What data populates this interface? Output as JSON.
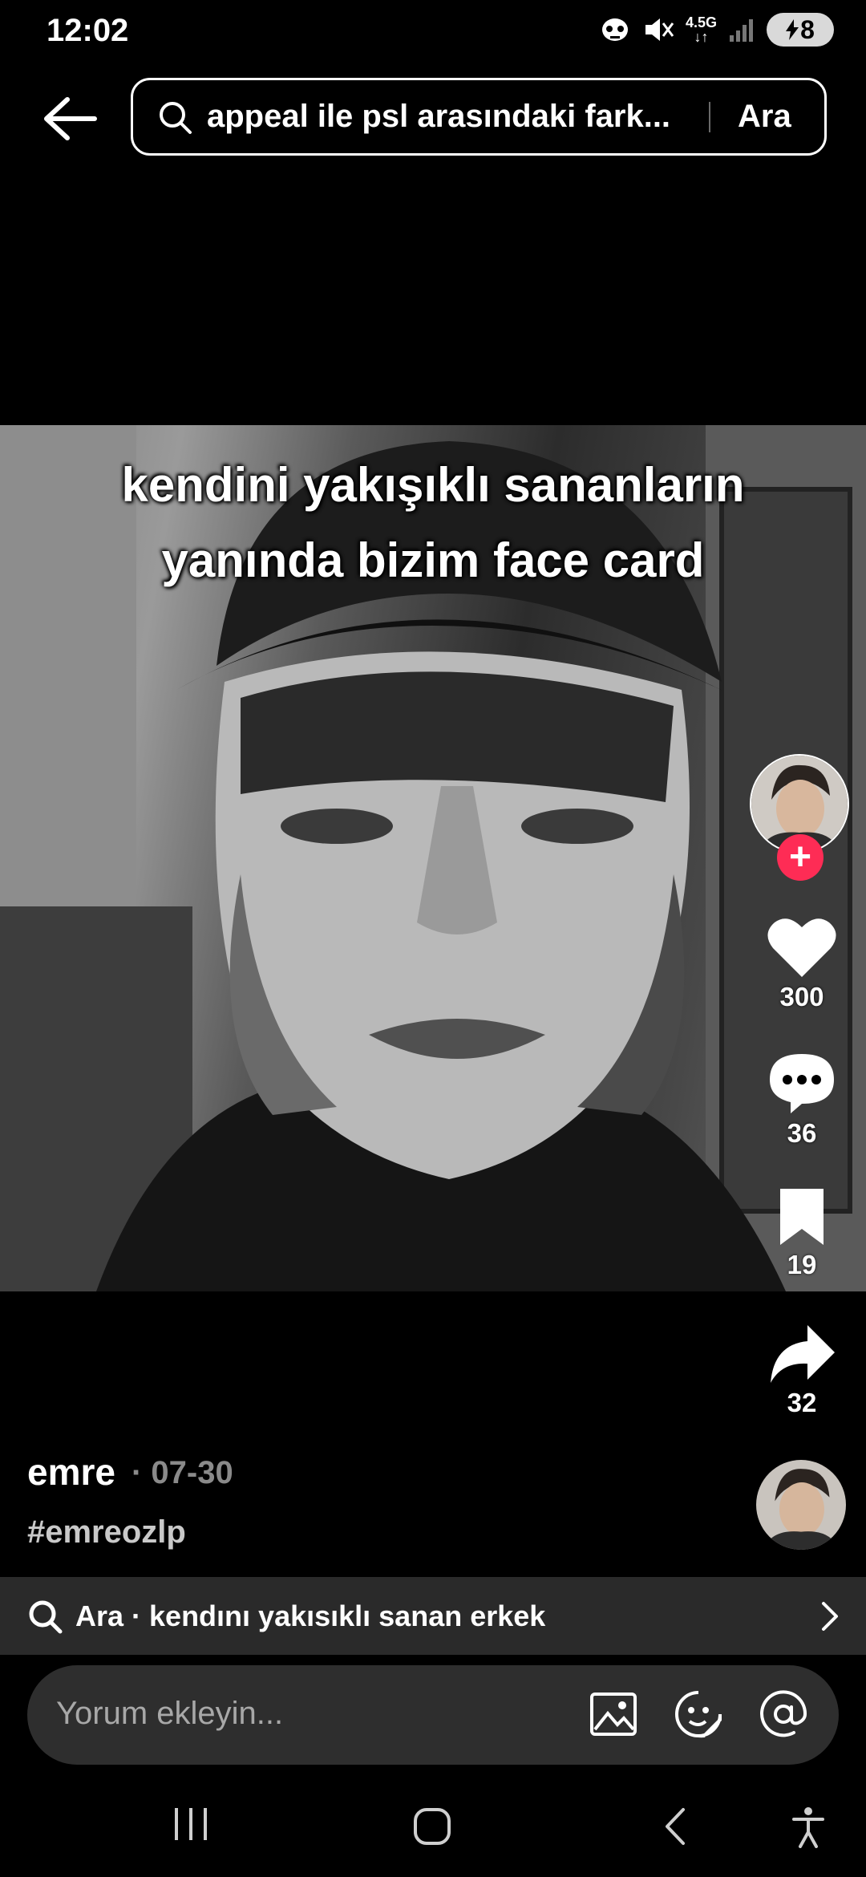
{
  "status_bar": {
    "time": "12:02",
    "network": "4.5G",
    "battery": "8"
  },
  "search": {
    "query": "appeal ile psl arasındaki fark...",
    "button_label": "Ara"
  },
  "video": {
    "caption_line1": "kendini yakışıklı sananların",
    "caption_line2": "yanında bizim face card"
  },
  "actions": {
    "likes": "300",
    "comments": "36",
    "saves": "19",
    "shares": "32"
  },
  "post": {
    "author": "emre",
    "date": "· 07-30",
    "hashtag": "#emreozlp"
  },
  "related_search": {
    "text": "Ara · kendını yakısıklı sanan erkek"
  },
  "comment_input": {
    "placeholder": "Yorum ekleyin..."
  },
  "colors": {
    "accent": "#fe2c55",
    "background": "#000000",
    "bar": "#2a2a2a"
  }
}
